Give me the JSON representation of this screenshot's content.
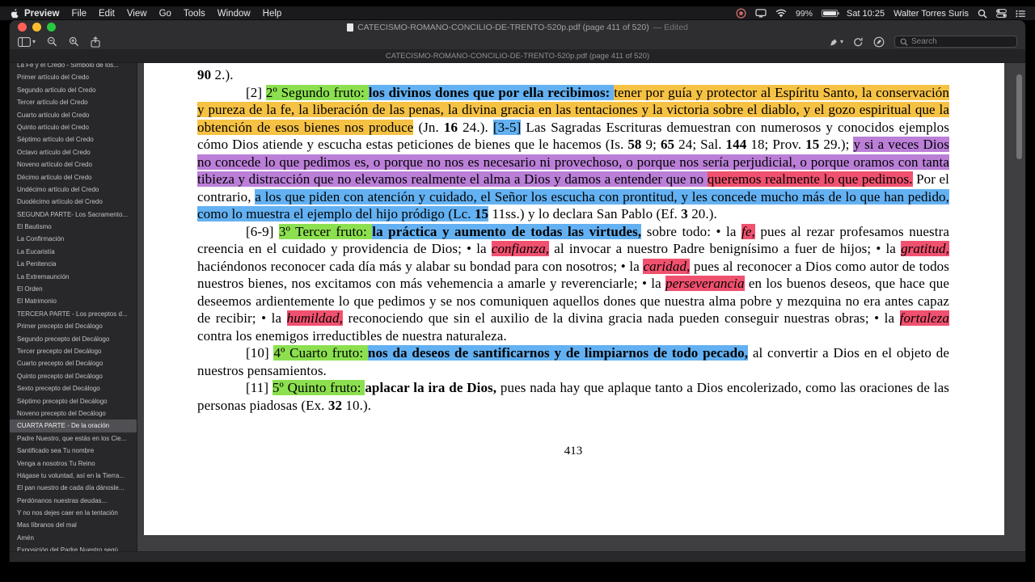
{
  "colors": {
    "green": "#8ce04f",
    "blue": "#63b1f2",
    "orange": "#f6c244",
    "purple": "#bb7fd8",
    "red": "#f0516f"
  },
  "menubar": {
    "items": [
      "Preview",
      "File",
      "Edit",
      "View",
      "Go",
      "Tools",
      "Window",
      "Help"
    ],
    "battery": "99%",
    "clock": "Sat 10:25",
    "user": "Walter Torres Suris"
  },
  "window": {
    "title_main": "CATECISMO-ROMANO-CONCILIO-DE-TRENTO-520p.pdf (page 411 of 520)",
    "title_edited": " — Edited",
    "tab_title": "CATECISMO-ROMANO-CONCILIO-DE-TRENTO-520p.pdf (page 411 of 520)",
    "search_placeholder": "Search"
  },
  "sidebar": {
    "selected_index": 29,
    "items": [
      "La Fe y el Credo - Símbolo de los...",
      "Primer artículo del Credo",
      "Segundo artículo del Credo",
      "Tercer artículo del Credo",
      "Cuarto artículo del Credo",
      "Quinto artículo del Credo",
      "Séptimo artículo del Credo",
      "Octavo artículo del Credo",
      "Noveno artículo del Credo",
      "Décimo artículo del Credo",
      "Undécimo artículo del Credo",
      "Duodécimo artículo del Credo",
      "SEGUNDA PARTE- Los Sacramento...",
      "El Bautismo",
      "La Confirmación",
      "La Eucaristía",
      "La Penitencia",
      "La Extremaunción",
      "El Orden",
      "El Matrimonio",
      "TERCERA PARTE - Los preceptos d...",
      "Primer precepto del Decálogo",
      "Segundo precepto del Decálogo",
      "Tercer precepto del Decálogo",
      "Cuarto precepto del Decálogo",
      "Quinto precepto del Decálogo",
      "Sexto precepto del Decálogo",
      "Séptimo precepto del Decálogo",
      "Noveno precepto del Decálogo",
      "CUARTA PARTE - De la oración",
      "Padre Nuestro, que estás en los Cie...",
      "Santificado sea Tu nombre",
      "Venga a nosotros Tu Reino",
      "Hágase tu voluntad, así en la Tierra...",
      "El pan nuestro de cada día dánosle...",
      "Perdónanos nuestras deudas...",
      "Y no nos dejes caer en la tentación",
      "Mas líbranos del mal",
      "Amén",
      "Exposición del Padre Nuestro segú..."
    ]
  },
  "page": {
    "number": "413",
    "paragraphs": [
      {
        "indent": false,
        "runs": [
          {
            "t": "90",
            "s": "b"
          },
          {
            "t": " 2.).",
            "s": "n"
          }
        ]
      },
      {
        "indent": true,
        "runs": [
          {
            "t": "[2] ",
            "s": "n"
          },
          {
            "t": "2º Segundo fruto: ",
            "s": "g"
          },
          {
            "t": "los divinos dones que por ella recibimos: ",
            "s": "bb"
          },
          {
            "t": "tener por guía y protector al Espíritu Santo, la conservación y pureza de la fe, la liberación de las penas, la divina gracia en las tentaciones y la victoria sobre el diablo, y el gozo espiritual que la obtención de esos bienes nos produce",
            "s": "o"
          },
          {
            "t": " (Jn. ",
            "s": "n"
          },
          {
            "t": "16",
            "s": "b"
          },
          {
            "t": " 24.). ",
            "s": "n"
          },
          {
            "t": "[3-5]",
            "s": "bl"
          },
          {
            "t": " Las Sagradas Escrituras demuestran con numerosos y conocidos ejemplos cómo Dios atiende y escucha estas peticiones de bienes que le hacemos (Is. ",
            "s": "n"
          },
          {
            "t": "58",
            "s": "b"
          },
          {
            "t": " 9; ",
            "s": "n"
          },
          {
            "t": "65",
            "s": "b"
          },
          {
            "t": " 24; Sal. ",
            "s": "n"
          },
          {
            "t": "144",
            "s": "b"
          },
          {
            "t": " 18; Prov. ",
            "s": "n"
          },
          {
            "t": "15",
            "s": "b"
          },
          {
            "t": " 29.); ",
            "s": "n"
          },
          {
            "t": "y si a veces Dios no concede lo que pedimos es, o porque no nos es necesario ni provechoso, o porque nos sería perjudicial, o porque oramos con tanta tibieza y distracción que no elevamos realmente el alma a Dios y damos a entender que no ",
            "s": "p"
          },
          {
            "t": "queremos realmente lo que pedimos.",
            "s": "r"
          },
          {
            "t": " Por el contrario, ",
            "s": "n"
          },
          {
            "t": "a los que piden con atención y cuidado, el Señor los escucha con prontitud, y les concede mucho más de lo que han pedido, como lo muestra el ejemplo del hijo pródigo (Lc. ",
            "s": "bl"
          },
          {
            "t": "15",
            "s": "bb"
          },
          {
            "t": " 11ss.) y lo declara San Pablo (Ef. ",
            "s": "n"
          },
          {
            "t": "3",
            "s": "b"
          },
          {
            "t": " 20.).",
            "s": "n"
          }
        ]
      },
      {
        "indent": true,
        "runs": [
          {
            "t": "[6-9] ",
            "s": "n"
          },
          {
            "t": "3º Tercer fruto: ",
            "s": "g"
          },
          {
            "t": "la práctica y aumento de todas las virtudes,",
            "s": "bb"
          },
          {
            "t": " sobre todo: • la ",
            "s": "n"
          },
          {
            "t": "fe,",
            "s": "ri"
          },
          {
            "t": " pues al rezar profesamos nuestra creencia en el cuidado y providencia de Dios; • la ",
            "s": "n"
          },
          {
            "t": "confianza,",
            "s": "ri"
          },
          {
            "t": " al invocar a nuestro Padre benignísimo a fuer de hijos; • la ",
            "s": "n"
          },
          {
            "t": "gratitud,",
            "s": "ri"
          },
          {
            "t": " haciéndonos reconocer cada día más y alabar su bondad para con nosotros; • la ",
            "s": "n"
          },
          {
            "t": "caridad,",
            "s": "ri"
          },
          {
            "t": " pues al reconocer a Dios como autor de todos nuestros bienes, nos excitamos con más vehemencia a amarle y reverenciarle; • la ",
            "s": "n"
          },
          {
            "t": "perseverancia",
            "s": "ri"
          },
          {
            "t": " en los buenos deseos, que hace que deseemos ardientemente lo que pedimos y se nos comuniquen aquellos dones que nuestra alma pobre y mezquina no era antes capaz de recibir; • la ",
            "s": "n"
          },
          {
            "t": "humildad,",
            "s": "ri"
          },
          {
            "t": " reconociendo que sin el auxilio de la divina gracia nada pueden conseguir nuestras obras; • la ",
            "s": "n"
          },
          {
            "t": "fortaleza",
            "s": "ri"
          },
          {
            "t": " contra los enemigos irreductibles de nuestra naturaleza.",
            "s": "n"
          }
        ]
      },
      {
        "indent": true,
        "runs": [
          {
            "t": "[10] ",
            "s": "n"
          },
          {
            "t": "4º Cuarto fruto: ",
            "s": "g"
          },
          {
            "t": "nos da deseos de santificarnos y de limpiarnos de todo pecado,",
            "s": "bb"
          },
          {
            "t": " al convertir a Dios en el objeto de nuestros pensamientos.",
            "s": "n"
          }
        ]
      },
      {
        "indent": true,
        "runs": [
          {
            "t": "[11] ",
            "s": "n"
          },
          {
            "t": "5º Quinto fruto: ",
            "s": "g"
          },
          {
            "t": "aplacar la ira de Dios,",
            "s": "b"
          },
          {
            "t": " pues nada hay que aplaque tanto a Dios encolerizado, como las oraciones de las personas piadosas (Ex. ",
            "s": "n"
          },
          {
            "t": "32",
            "s": "b"
          },
          {
            "t": " 10.).",
            "s": "n"
          }
        ]
      }
    ]
  }
}
